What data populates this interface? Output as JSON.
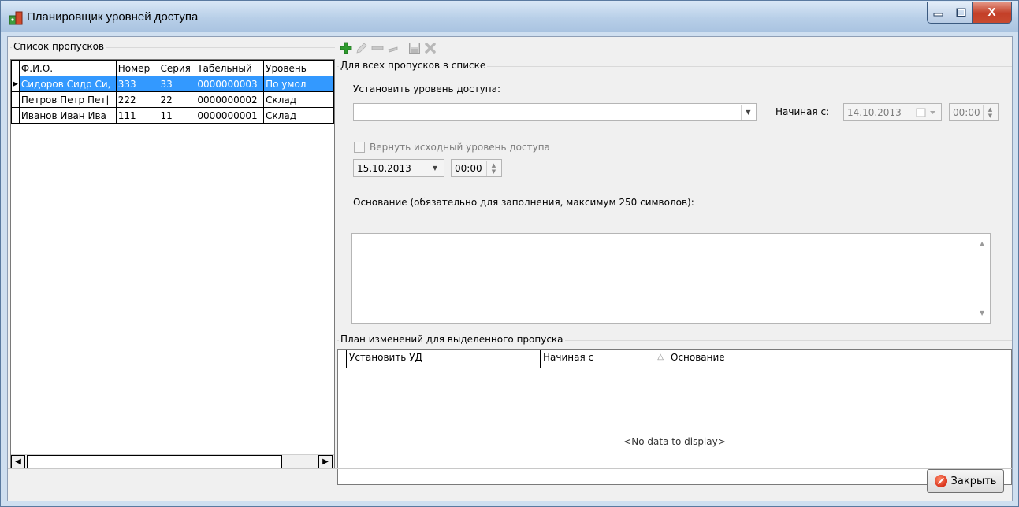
{
  "window": {
    "title": "Планировщик уровней доступа",
    "minimize_glyph": "—",
    "maximize_glyph": "□",
    "close_glyph": "X"
  },
  "left": {
    "group_title": "Список пропусков",
    "columns": [
      "Ф.И.О.",
      "Номер",
      "Серия",
      "Табельный",
      "Уровень"
    ],
    "rows": [
      {
        "indicator": "▶",
        "fio": "Сидоров Сидр Си,",
        "number": "333",
        "series": "33",
        "tab": "0000000003",
        "level": "По умол",
        "selected": true
      },
      {
        "indicator": "",
        "fio": "Петров Петр Пет|",
        "number": "222",
        "series": "22",
        "tab": "0000000002",
        "level": "Склад",
        "selected": false
      },
      {
        "indicator": "",
        "fio": "Иванов Иван Ива",
        "number": "111",
        "series": "11",
        "tab": "0000000001",
        "level": "Склад",
        "selected": false
      }
    ],
    "scroll_left": "◀",
    "scroll_right": "▶"
  },
  "toolbar": {
    "add": "add-icon",
    "edit": "pencil-icon",
    "remove": "minus-icon",
    "clear": "eraser-icon",
    "save": "save-icon",
    "cancel": "cancel-icon"
  },
  "all_passes": {
    "group_title": "Для всех пропусков в списке",
    "set_level_label": "Установить уровень доступа:",
    "level_value": "",
    "start_label": "Начиная с:",
    "start_date": "14.10.2013",
    "start_time": "00:00",
    "revert_label": "Вернуть исходный уровень доступа",
    "revert_date": "15.10.2013",
    "revert_time": "00:00",
    "reason_label": "Основание (обязательно для заполнения, максимум 250 символов):",
    "reason_value": ""
  },
  "plan": {
    "group_title": "План изменений для выделенного пропуска",
    "columns": [
      "Установить УД",
      "Начиная с",
      "Основание"
    ],
    "sort_glyph": "△",
    "empty_text": "<No data to display>"
  },
  "footer": {
    "close_label": "Закрыть"
  },
  "colors": {
    "selection": "#3399ff",
    "add_icon": "#2e9a2e",
    "close_button": "#c33f28"
  }
}
